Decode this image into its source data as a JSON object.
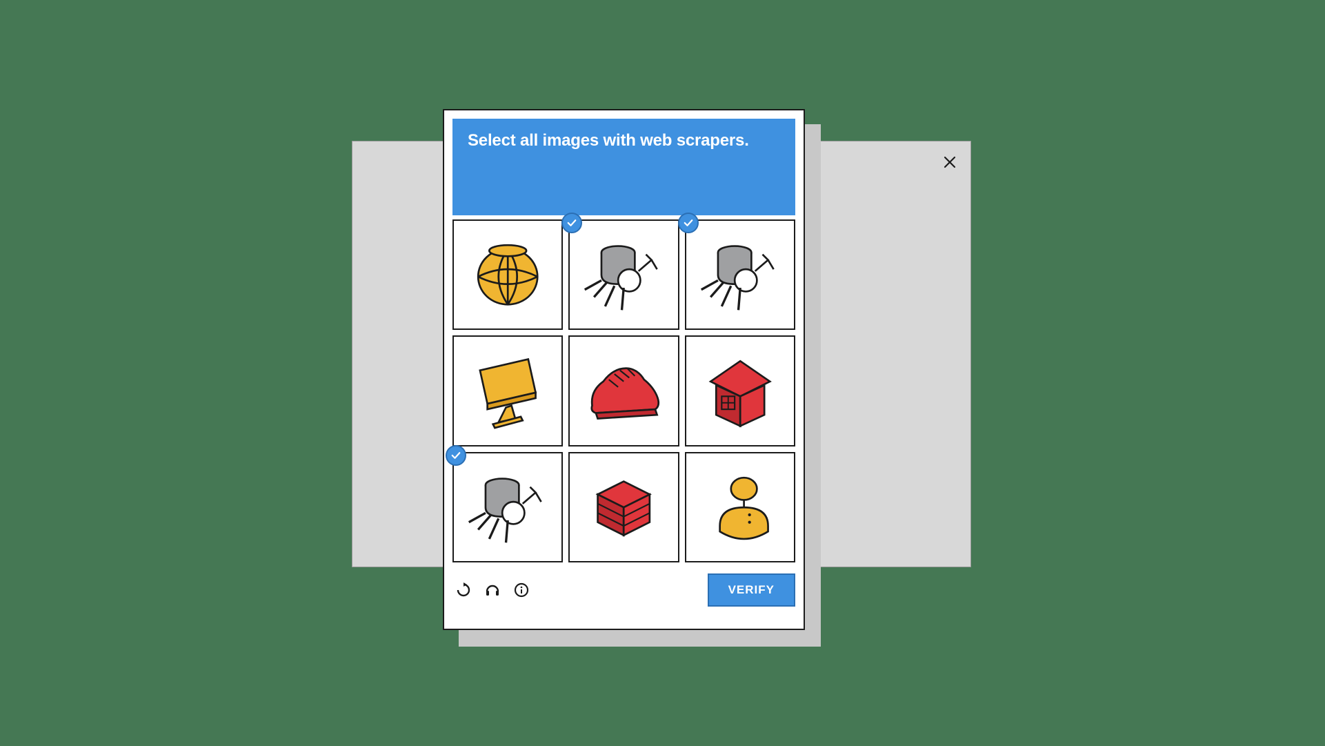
{
  "captcha": {
    "instruction": "Select all images with web scrapers.",
    "verify_label": "VERIFY",
    "tiles": [
      {
        "name": "globe",
        "selected": false
      },
      {
        "name": "web-scraper",
        "selected": true
      },
      {
        "name": "web-scraper",
        "selected": true
      },
      {
        "name": "monitor",
        "selected": false
      },
      {
        "name": "shoe",
        "selected": false
      },
      {
        "name": "house",
        "selected": false
      },
      {
        "name": "web-scraper",
        "selected": true
      },
      {
        "name": "server",
        "selected": false
      },
      {
        "name": "person",
        "selected": false
      }
    ]
  },
  "colors": {
    "accent": "#3f91e0",
    "yellow": "#f0b531",
    "red": "#e0363c",
    "gray": "#9fa0a2"
  }
}
